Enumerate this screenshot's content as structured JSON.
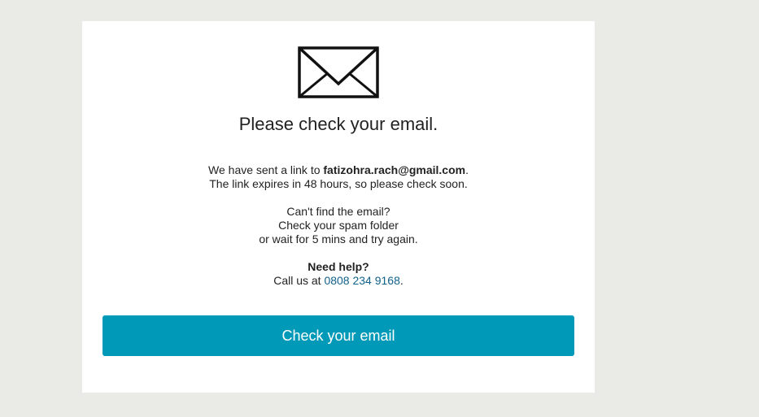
{
  "icon": "envelope-icon",
  "title": "Please check your email.",
  "sent": {
    "prefix": "We have sent a link to ",
    "email": "fatizohra.rach@gmail.com",
    "suffix": ".",
    "expiry": "The link expires in 48 hours, so please check soon."
  },
  "cant_find": {
    "line1": "Can't find the email?",
    "line2": "Check your spam folder",
    "line3": "or wait for 5 mins and try again."
  },
  "help": {
    "heading": "Need help?",
    "call_prefix": "Call us at ",
    "phone": "0808 234 9168",
    "call_suffix": "."
  },
  "button_label": "Check your email",
  "colors": {
    "background": "#eaeae6",
    "card": "#ffffff",
    "button": "#0099b8",
    "link": "#11628a"
  }
}
